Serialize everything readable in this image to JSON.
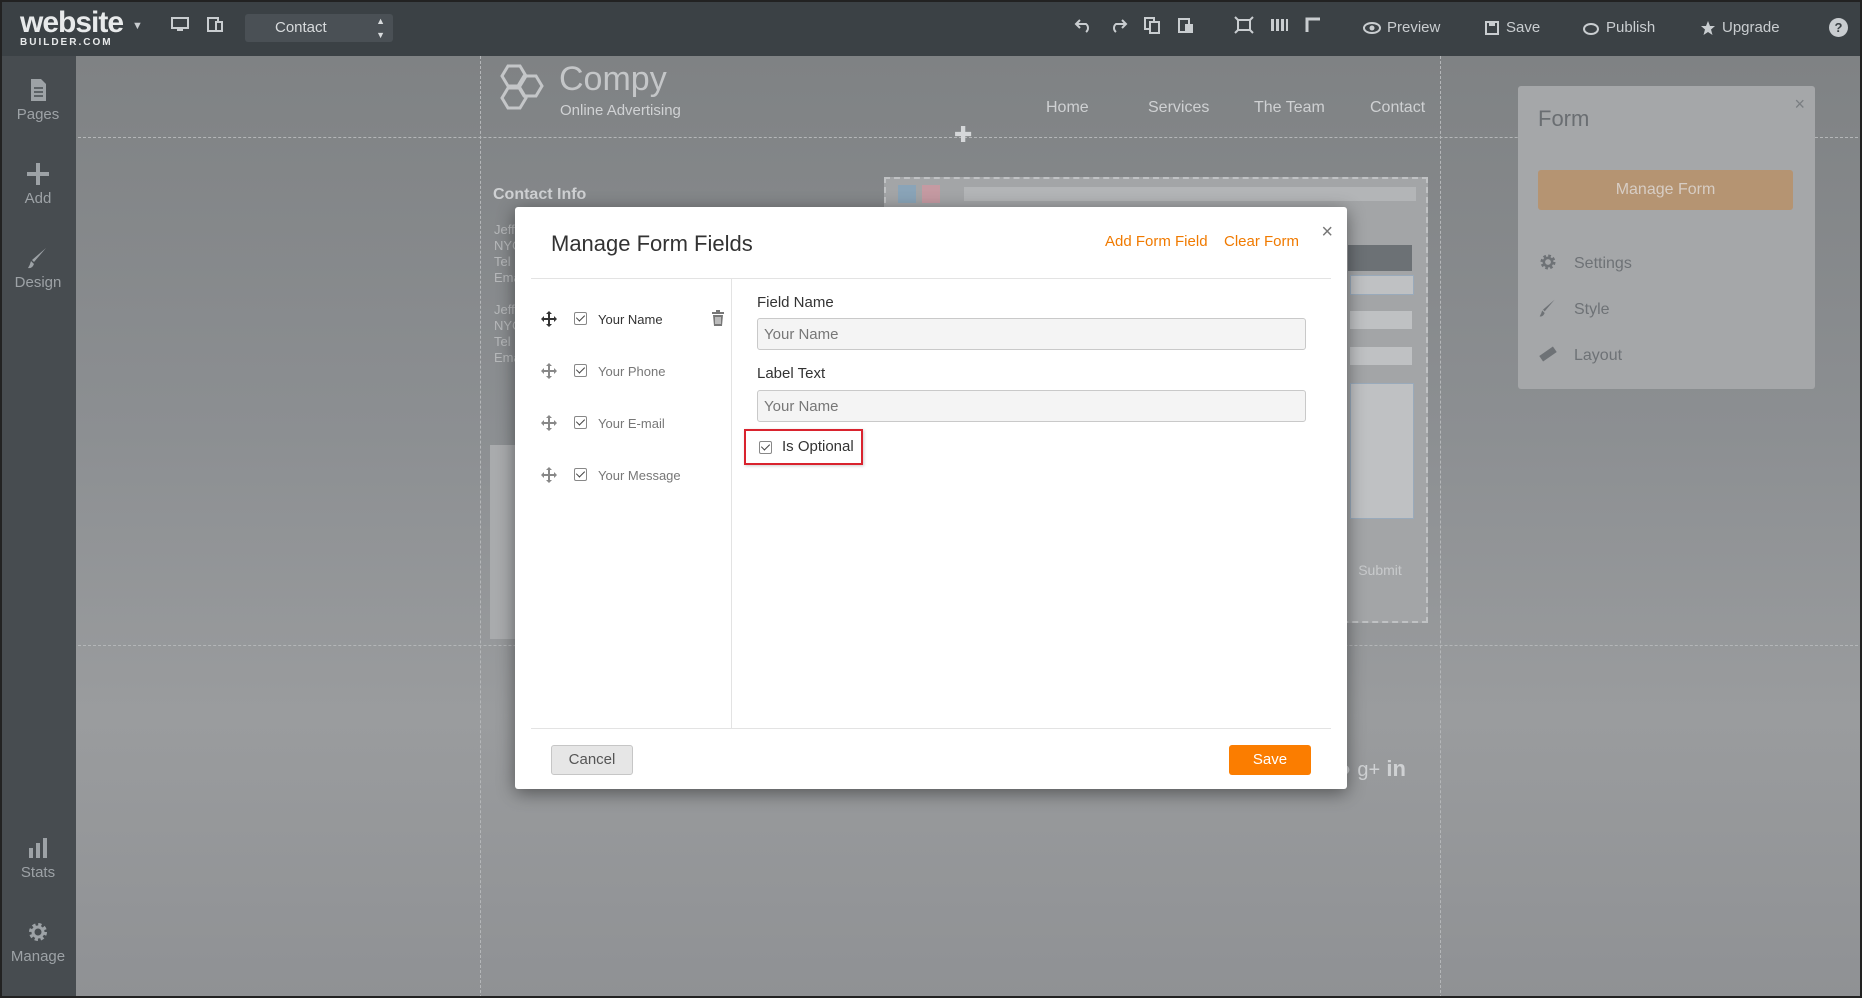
{
  "topbar": {
    "logo_main": "website",
    "logo_sub": "BUILDER.COM",
    "page_select": "Contact",
    "preview": "Preview",
    "save": "Save",
    "publish": "Publish",
    "upgrade": "Upgrade",
    "help": "?"
  },
  "sidebar": {
    "items": [
      {
        "label": "Pages",
        "icon": "pages-icon"
      },
      {
        "label": "Add",
        "icon": "plus-icon"
      },
      {
        "label": "Design",
        "icon": "brush-icon"
      },
      {
        "label": "Stats",
        "icon": "bar-chart-icon"
      },
      {
        "label": "Manage",
        "icon": "gear-icon"
      }
    ]
  },
  "site": {
    "name": "Compy",
    "tagline": "Online Advertising",
    "nav": [
      "Home",
      "Services",
      "The Team",
      "Contact"
    ],
    "contact_heading": "Contact Info",
    "contact_lines": [
      "Jeff",
      "NYC",
      "Tel",
      "Ema",
      "",
      "Jeff",
      "NYC",
      "Tel",
      "Ema"
    ],
    "submit": "Submit"
  },
  "right_panel": {
    "title": "Form",
    "close": "×",
    "manage_button": "Manage Form",
    "items": [
      {
        "label": "Settings",
        "icon": "gear-icon"
      },
      {
        "label": "Style",
        "icon": "brush-icon"
      },
      {
        "label": "Layout",
        "icon": "ruler-icon"
      }
    ]
  },
  "modal": {
    "title": "Manage Form Fields",
    "add_field": "Add Form Field",
    "clear_form": "Clear Form",
    "close": "×",
    "fields": [
      {
        "name": "Your Name",
        "checked": true,
        "active": true
      },
      {
        "name": "Your Phone",
        "checked": true,
        "active": false
      },
      {
        "name": "Your E-mail",
        "checked": true,
        "active": false
      },
      {
        "name": "Your Message",
        "checked": true,
        "active": false
      }
    ],
    "field_name_label": "Field Name",
    "field_name_value": "Your Name",
    "label_text_label": "Label Text",
    "label_text_value": "Your Name",
    "is_optional_label": "Is Optional",
    "is_optional_checked": true,
    "cancel": "Cancel",
    "save": "Save"
  },
  "colors": {
    "accent": "#fb7d00",
    "link": "#f07a00",
    "highlight": "#d9232e",
    "toolbar": "#3b4145"
  }
}
